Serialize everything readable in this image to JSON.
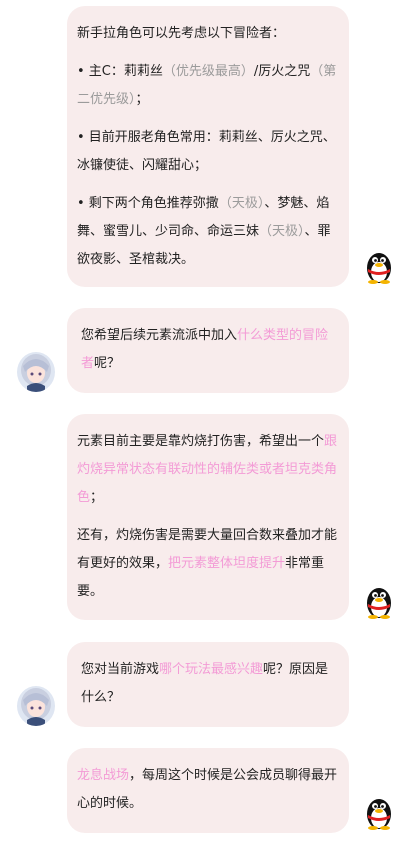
{
  "messages": [
    {
      "sender": "bot",
      "paragraphs": [
        {
          "segments": [
            {
              "t": "新手拉角色可以先考虑以下冒险者：",
              "c": ""
            }
          ]
        },
        {
          "segments": [
            {
              "t": "• 主C：莉莉丝",
              "c": ""
            },
            {
              "t": "（优先级最高）",
              "c": "gray"
            },
            {
              "t": "/厉火之咒",
              "c": ""
            },
            {
              "t": "（第二优先级）",
              "c": "gray"
            },
            {
              "t": "；",
              "c": ""
            }
          ]
        },
        {
          "segments": [
            {
              "t": "• 目前开服老角色常用：莉莉丝、厉火之咒、冰镰使徒、闪耀甜心；",
              "c": ""
            }
          ]
        },
        {
          "segments": [
            {
              "t": "• 剩下两个角色推荐弥撒",
              "c": ""
            },
            {
              "t": "（天极）",
              "c": "gray"
            },
            {
              "t": "、梦魅、焰舞、蜜雪儿、少司命、命运三妹",
              "c": ""
            },
            {
              "t": "（天极）",
              "c": "gray"
            },
            {
              "t": "、罪欲夜影、圣棺裁决。",
              "c": ""
            }
          ]
        }
      ]
    },
    {
      "sender": "user",
      "paragraphs": [
        {
          "segments": [
            {
              "t": "您希望后续元素流派中加入",
              "c": ""
            },
            {
              "t": "什么类型的冒险者",
              "c": "pink"
            },
            {
              "t": "呢？",
              "c": ""
            }
          ]
        }
      ]
    },
    {
      "sender": "bot",
      "paragraphs": [
        {
          "segments": [
            {
              "t": "元素目前主要是靠灼烧打伤害，希望出一个",
              "c": ""
            },
            {
              "t": "跟灼烧异常状态有联动性的辅佐类或者坦克类角色",
              "c": "pink"
            },
            {
              "t": "；",
              "c": ""
            }
          ]
        },
        {
          "segments": [
            {
              "t": "还有，灼烧伤害是需要大量回合数来叠加才能有更好的效果，",
              "c": ""
            },
            {
              "t": "把元素整体坦度提升",
              "c": "pink"
            },
            {
              "t": "非常重要。",
              "c": ""
            }
          ]
        }
      ]
    },
    {
      "sender": "user",
      "paragraphs": [
        {
          "segments": [
            {
              "t": "您对当前游戏",
              "c": ""
            },
            {
              "t": "哪个玩法最感兴趣",
              "c": "pink"
            },
            {
              "t": "呢？原因是什么？",
              "c": ""
            }
          ]
        }
      ]
    },
    {
      "sender": "bot",
      "paragraphs": [
        {
          "segments": [
            {
              "t": "龙息战场",
              "c": "pink"
            },
            {
              "t": "，每周这个时候是公会成员聊得最开心的时候。",
              "c": ""
            }
          ]
        }
      ]
    }
  ],
  "colors": {
    "bubble": "#f8ecec",
    "highlight": "#f39bd6",
    "muted": "#9b9b9b"
  },
  "icons": {
    "bot_avatar": "qq-penguin-icon",
    "user_avatar": "anime-girl-avatar-icon"
  }
}
